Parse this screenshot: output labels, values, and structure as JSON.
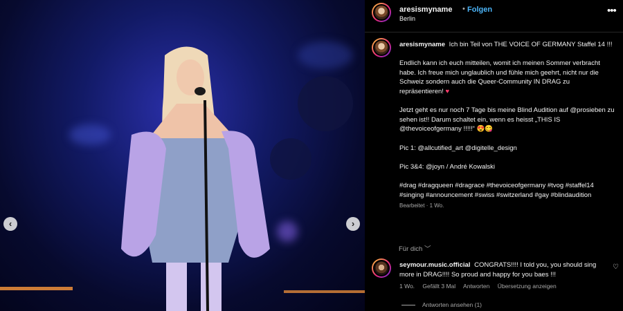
{
  "post": {
    "username": "aresismyname",
    "dot": "•",
    "follow_label": "Folgen",
    "location": "Berlin",
    "more_icon": "more-horizontal-icon"
  },
  "caption": {
    "username": "aresismyname",
    "line1": "Ich bin Teil von THE VOICE OF GERMANY Staffel 14 !!!",
    "para2": "Endlich kann ich euch mitteilen, womit ich meinen Sommer verbracht habe. Ich freue mich unglaublich und fühle mich geehrt, nicht nur die Schweiz sondern auch die Queer-Community IN DRAG zu repräsentieren!",
    "para2_emoji": "♥",
    "para3": "Jetzt geht es nur noch 7 Tage bis meine Blind Audition auf @prosieben zu sehen ist!! Darum schaltet ein, wenn es heisst „THIS IS @thevoiceofgermany !!!!!“",
    "para3_emoji": "😍😋",
    "pic1": "Pic 1: @allcutified_art @digitelle_design",
    "pic34": "Pic 3&4: @joyn / André Kowalski",
    "hashtags": "#drag #dragqueen #dragrace #thevoiceofgermany #tvog #staffel14 #singing #announcement #swiss #switzerland #gay #blindaudition",
    "edited": "Bearbeitet · 1 Wo."
  },
  "for_you_label": "Für dich ﹀",
  "comment": {
    "username": "seymour.music.official",
    "text": "CONGRATS!!!! I told you, you should sing more in DRAG!!!! So proud and happy for you baes !!!",
    "age": "1 Wo.",
    "likes": "Gefällt 3 Mal",
    "reply_label": "Antworten",
    "translate_label": "Übersetzung anzeigen",
    "view_replies": "Antworten ansehen (1)",
    "like_icon": "heart-outline-icon"
  },
  "media": {
    "prev_icon": "chevron-left-icon",
    "next_icon": "chevron-right-icon",
    "prev_glyph": "‹",
    "next_glyph": "›"
  },
  "colors": {
    "background": "#000000",
    "follow": "#4cb5f9",
    "muted": "#a8a8a8",
    "text": "#f5f5f5",
    "stage_blue": "#1a2290",
    "dress_lilac": "#b9a3e6"
  }
}
